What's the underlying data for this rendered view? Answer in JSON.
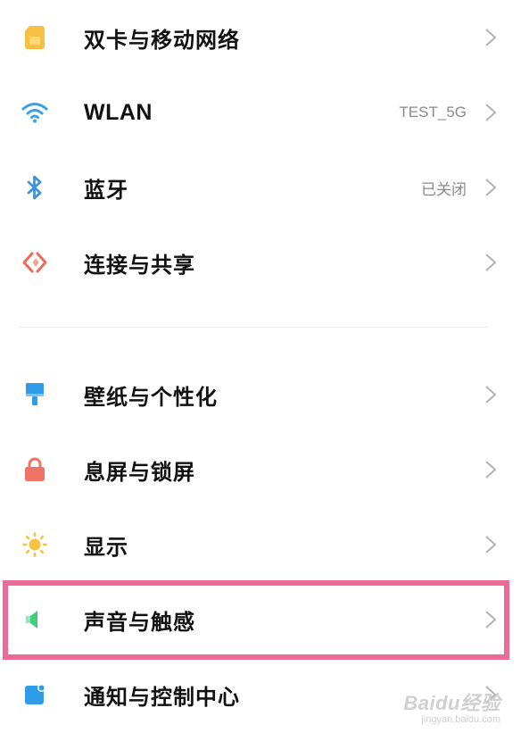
{
  "settings": {
    "group1": [
      {
        "label": "双卡与移动网络",
        "value": "",
        "icon": "sim-card-icon",
        "color": "#f6c143"
      },
      {
        "label": "WLAN",
        "value": "TEST_5G",
        "icon": "wifi-icon",
        "color": "#3aa1e8"
      },
      {
        "label": "蓝牙",
        "value": "已关闭",
        "icon": "bluetooth-icon",
        "color": "#3a93e0"
      },
      {
        "label": "连接与共享",
        "value": "",
        "icon": "connection-sharing-icon",
        "color": "#ec6b57"
      }
    ],
    "group2": [
      {
        "label": "壁纸与个性化",
        "value": "",
        "icon": "paint-brush-icon",
        "color": "#2f9ce8"
      },
      {
        "label": "息屏与锁屏",
        "value": "",
        "icon": "lock-icon",
        "color": "#ef7465"
      },
      {
        "label": "显示",
        "value": "",
        "icon": "sun-icon",
        "color": "#f5c242"
      },
      {
        "label": "声音与触感",
        "value": "",
        "icon": "speaker-icon",
        "color": "#3fcf7c"
      },
      {
        "label": "通知与控制中心",
        "value": "",
        "icon": "notification-icon",
        "color": "#2f9ce8"
      }
    ]
  },
  "highlight": {
    "target": "声音与触感",
    "color": "#ec6a94"
  },
  "watermark": {
    "text": "Baidu经验",
    "url": "jingyan.baidu.com"
  }
}
